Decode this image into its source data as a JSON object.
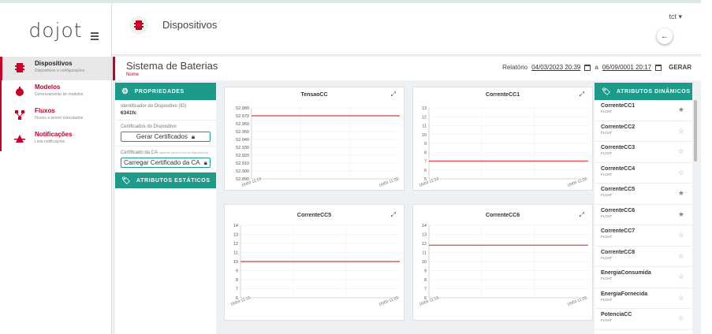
{
  "app": {
    "logo": "dojot"
  },
  "sidebar": {
    "items": [
      {
        "label": "Dispositivos",
        "sub": "Dispositivos e configurações",
        "color": "#c7002a"
      },
      {
        "label": "Modelos",
        "sub": "Gerenciamento de modelos",
        "color": "#c7002a"
      },
      {
        "label": "Fluxos",
        "sub": "Fluxos a serem executados",
        "color": "#c7002a"
      },
      {
        "label": "Notificações",
        "sub": "Lista notificações",
        "color": "#c7002a"
      }
    ]
  },
  "header": {
    "title": "Dispositivos",
    "user": "tct"
  },
  "device": {
    "name": "Sistema de Baterias",
    "subtitle": "Nome"
  },
  "report": {
    "label": "Relatório",
    "from": "04/03/2023 20:39",
    "sep": "a",
    "to": "06/09/0001 20:17",
    "action": "GERAR"
  },
  "props": {
    "title": "PROPRIEDADES",
    "id_label": "Identificador do Dispositivo (ID)",
    "id_value": "6341fc",
    "cert_label": "Certificados do Dispositivo",
    "cert_button": "Gerar Certificados",
    "ca_label": "Certificado da CA",
    "ca_note": "(apenas para todos os dispositivos)",
    "ca_button": "Carregar Certificado da CA",
    "static_title": "ATRIBUTOS ESTÁTICOS"
  },
  "charts_common": {
    "x_start": "16/03 11:13",
    "x_end": "16/03 11:22",
    "accent": "#e05a5a"
  },
  "chart_data": [
    {
      "type": "line",
      "title": "TensaoCC",
      "yticks": [
        "52.980",
        "52.970",
        "52.960",
        "52.950",
        "52.940",
        "52.930",
        "52.920",
        "52.910",
        "52.900",
        "52.890"
      ],
      "ylim": [
        52.89,
        52.98
      ],
      "series": [
        {
          "values": [
            52.97,
            52.97
          ]
        }
      ]
    },
    {
      "type": "line",
      "title": "CorrenteCC1",
      "yticks": [
        "13",
        "12",
        "11",
        "10",
        "9",
        "8",
        "7",
        "6",
        "5"
      ],
      "ylim": [
        5,
        13
      ],
      "series": [
        {
          "values": [
            7,
            7
          ]
        }
      ]
    },
    {
      "type": "line",
      "title": "CorrenteCC5",
      "yticks": [
        "14",
        "13",
        "12",
        "11",
        "10",
        "9",
        "8",
        "7",
        "6"
      ],
      "ylim": [
        6,
        14
      ],
      "series": [
        {
          "values": [
            10,
            10
          ]
        }
      ]
    },
    {
      "type": "line",
      "title": "CorrenteCC6",
      "yticks": [
        "14",
        "13",
        "12",
        "11",
        "10",
        "9",
        "8",
        "7",
        "6"
      ],
      "ylim": [
        6,
        14
      ],
      "series": [
        {
          "values": [
            11.8,
            11.8
          ]
        }
      ]
    }
  ],
  "dynamic": {
    "title": "ATRIBUTOS DINÂMICOS",
    "items": [
      {
        "name": "CorrenteCC1",
        "type": "FLOAT",
        "starred": true
      },
      {
        "name": "CorrenteCC2",
        "type": "FLOAT",
        "starred": false
      },
      {
        "name": "CorrenteCC3",
        "type": "FLOAT",
        "starred": false
      },
      {
        "name": "CorrenteCC4",
        "type": "FLOAT",
        "starred": false
      },
      {
        "name": "CorrenteCC5",
        "type": "FLOAT",
        "starred": true
      },
      {
        "name": "CorrenteCC6",
        "type": "FLOAT",
        "starred": true
      },
      {
        "name": "CorrenteCC7",
        "type": "FLOAT",
        "starred": false
      },
      {
        "name": "CorrenteCC8",
        "type": "FLOAT",
        "starred": false
      },
      {
        "name": "EnergiaConsumida",
        "type": "FLOAT",
        "starred": false
      },
      {
        "name": "EnergiaFornecida",
        "type": "FLOAT",
        "starred": false
      },
      {
        "name": "PotenciaCC",
        "type": "FLOAT",
        "starred": false
      }
    ]
  }
}
